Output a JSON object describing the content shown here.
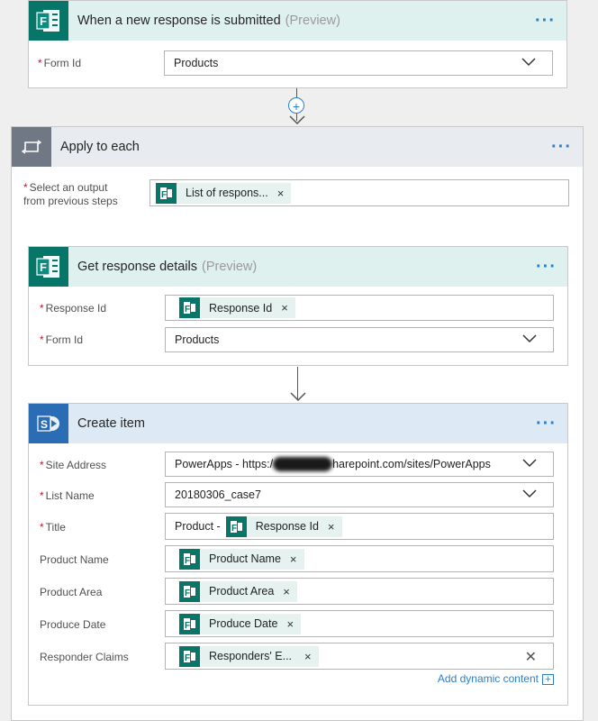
{
  "trigger": {
    "title": "When a new response is submitted",
    "preview": "(Preview)",
    "more": "···",
    "form_id_label": "Form Id",
    "form_id_value": "Products"
  },
  "apply_each": {
    "title": "Apply to each",
    "more": "···",
    "select_label_line1": "Select an output",
    "select_label_line2": "from previous steps",
    "token": "List of respons...",
    "token_close": "×"
  },
  "get_details": {
    "title": "Get response details",
    "preview": "(Preview)",
    "more": "···",
    "response_id_label": "Response Id",
    "response_id_token": "Response Id",
    "token_close": "×",
    "form_id_label": "Form Id",
    "form_id_value": "Products"
  },
  "create_item": {
    "title": "Create item",
    "more": "···",
    "site_address_label": "Site Address",
    "site_address_prefix": "PowerApps - https:/",
    "site_address_suffix": "harepoint.com/sites/PowerApps",
    "list_name_label": "List Name",
    "list_name_value": "20180306_case7",
    "title_label": "Title",
    "title_prefix": "Product -",
    "title_token": "Response Id",
    "product_name_label": "Product Name",
    "product_name_token": "Product Name",
    "product_area_label": "Product Area",
    "product_area_token": "Product Area",
    "produce_date_label": "Produce Date",
    "produce_date_token": "Produce Date",
    "responder_claims_label": "Responder Claims",
    "responder_claims_token": "Responders' E...",
    "token_close": "×",
    "clear": "✕",
    "add_dynamic": "Add dynamic content",
    "add_plus": "+"
  },
  "required_mark": "*",
  "colors": {
    "forms_green": "#077568",
    "sharepoint_blue": "#2a6db5",
    "loop_grey": "#6f7884",
    "link_blue": "#2a7fcf"
  }
}
